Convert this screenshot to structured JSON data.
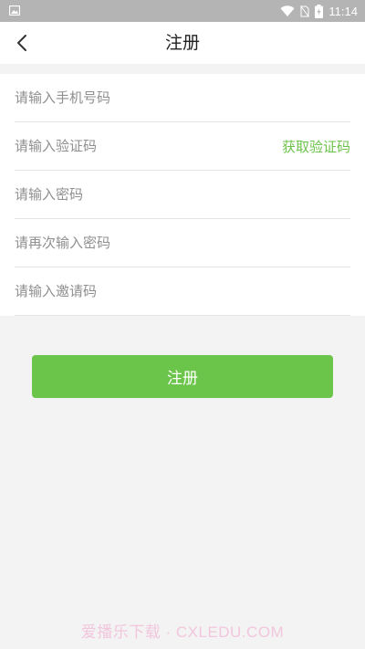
{
  "status_bar": {
    "time": "11:14",
    "icons": [
      "image-icon",
      "wifi-icon",
      "no-sim-icon",
      "battery-icon"
    ]
  },
  "nav": {
    "title": "注册",
    "back_icon": "chevron-left-icon"
  },
  "form": {
    "phone_placeholder": "请输入手机号码",
    "code_placeholder": "请输入验证码",
    "get_code_label": "获取验证码",
    "password_placeholder": "请输入密码",
    "confirm_password_placeholder": "请再次输入密码",
    "invite_placeholder": "请输入邀请码"
  },
  "register_label": "注册",
  "watermark": "爱播乐下载 · CXLEDU.COM",
  "colors": {
    "accent": "#6cc54b",
    "status_bar": "#b4b4b4",
    "background": "#f3f3f3"
  }
}
